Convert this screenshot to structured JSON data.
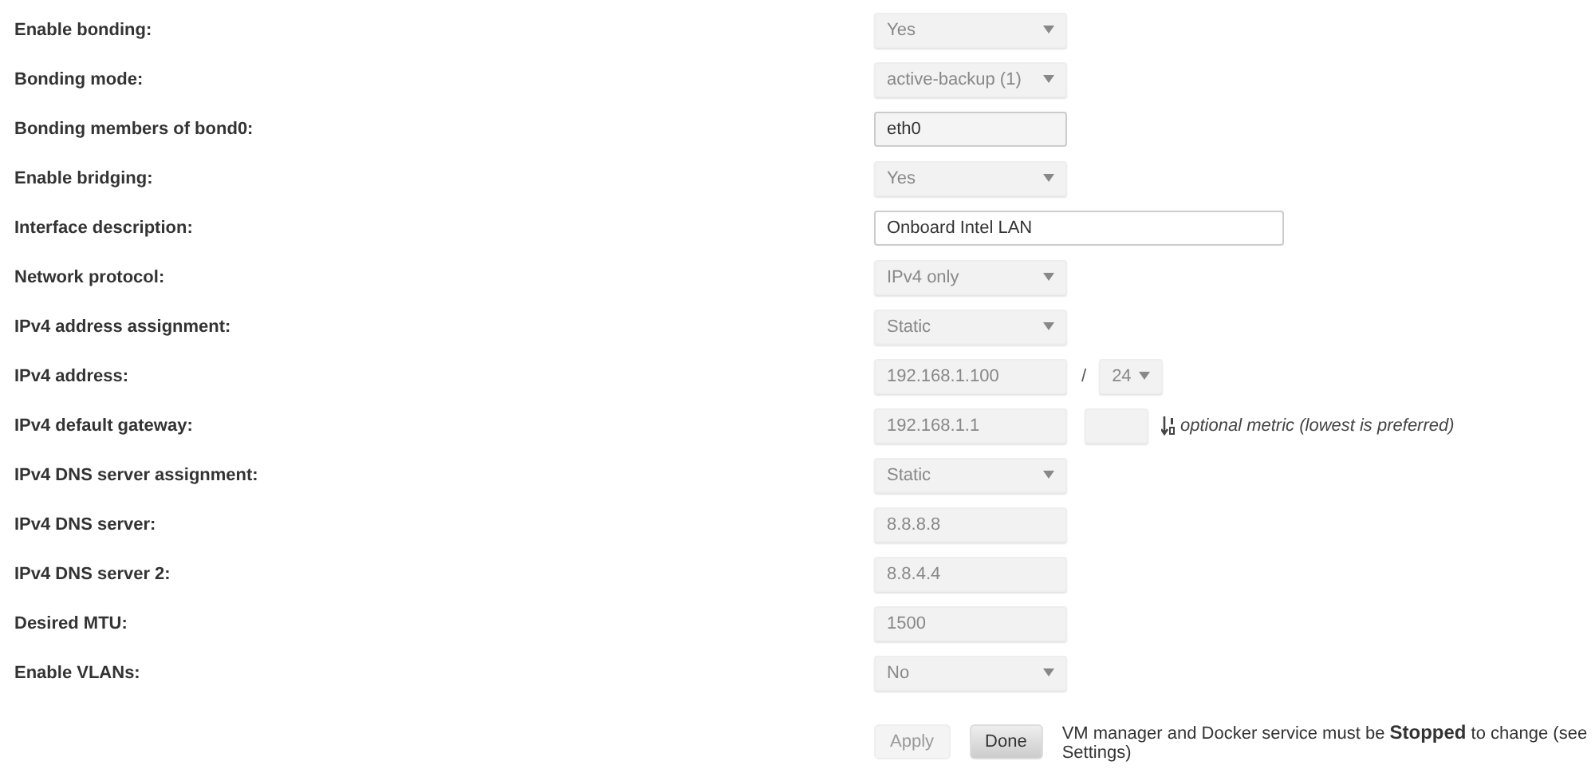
{
  "rows": [
    {
      "label": "Enable bonding:",
      "kind": "select",
      "value": "Yes",
      "disabled": true
    },
    {
      "label": "Bonding mode:",
      "kind": "select",
      "value": "active-backup (1)",
      "disabled": true
    },
    {
      "label": "Bonding members of bond0:",
      "kind": "input",
      "value": "eth0",
      "disabled": false
    },
    {
      "label": "Enable bridging:",
      "kind": "select",
      "value": "Yes",
      "disabled": true
    },
    {
      "label": "Interface description:",
      "kind": "wide",
      "value": "Onboard Intel LAN",
      "disabled": false
    },
    {
      "label": "Network protocol:",
      "kind": "select",
      "value": "IPv4 only",
      "disabled": true
    },
    {
      "label": "IPv4 address assignment:",
      "kind": "select",
      "value": "Static",
      "disabled": true
    },
    {
      "label": "IPv4 address:",
      "kind": "address",
      "value": "192.168.1.100",
      "disabled": true,
      "separator": "/",
      "prefix": "24"
    },
    {
      "label": "IPv4 default gateway:",
      "kind": "gateway",
      "value": "192.168.1.1",
      "disabled": true,
      "note": "optional metric (lowest is preferred)"
    },
    {
      "label": "IPv4 DNS server assignment:",
      "kind": "select",
      "value": "Static",
      "disabled": true
    },
    {
      "label": "IPv4 DNS server:",
      "kind": "input",
      "value": "8.8.8.8",
      "disabled": true
    },
    {
      "label": "IPv4 DNS server 2:",
      "kind": "input",
      "value": "8.8.4.4",
      "disabled": true
    },
    {
      "label": "Desired MTU:",
      "kind": "input",
      "value": "1500",
      "disabled": true
    },
    {
      "label": "Enable VLANs:",
      "kind": "select",
      "value": "No",
      "disabled": true
    }
  ],
  "buttons": [
    {
      "label": "Apply",
      "disabled": true
    },
    {
      "label": "Done",
      "disabled": false
    }
  ],
  "footer_note": "VM manager and Docker service must be **Stopped** to change (see Settings)"
}
